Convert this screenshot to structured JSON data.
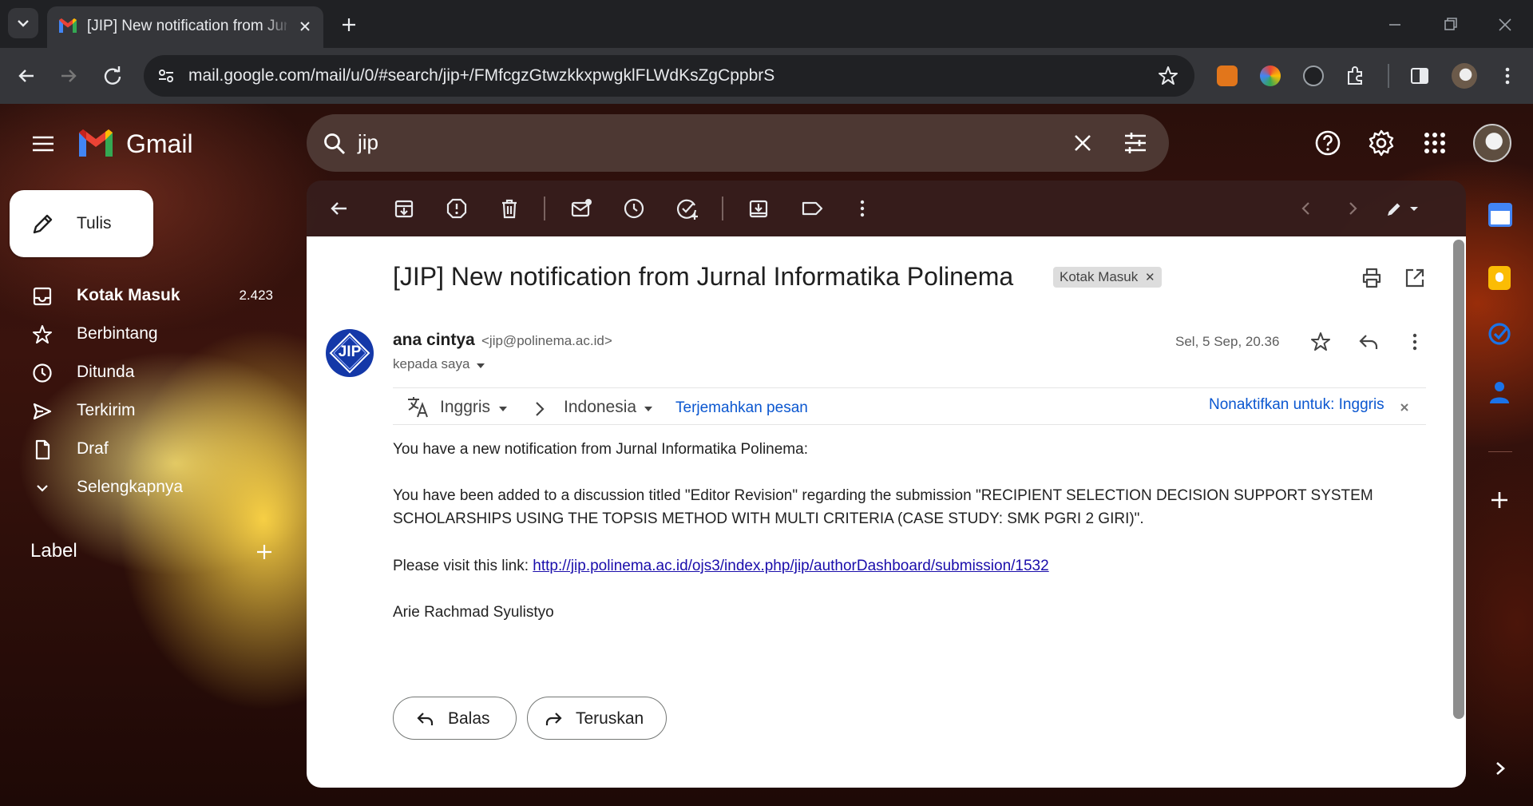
{
  "browser": {
    "tab_title": "[JIP] New notification from Jurnal Informatika Polinema",
    "url": "mail.google.com/mail/u/0/#search/jip+/FMfcgzGtwzkkxpwgklFLWdKsZgCppbrS"
  },
  "gmail": {
    "logo_text": "Gmail",
    "search_query": "jip",
    "compose_label": "Tulis",
    "nav": [
      {
        "label": "Kotak Masuk",
        "count": "2.423"
      },
      {
        "label": "Berbintang"
      },
      {
        "label": "Ditunda"
      },
      {
        "label": "Terkirim"
      },
      {
        "label": "Draf"
      },
      {
        "label": "Selengkapnya"
      }
    ],
    "labels_heading": "Label"
  },
  "message": {
    "subject": "[JIP] New notification from Jurnal Informatika Polinema",
    "label_chip": "Kotak Masuk",
    "sender_name": "ana cintya",
    "sender_email": "<jip@polinema.ac.id>",
    "to_line": "kepada saya",
    "date": "Sel, 5 Sep, 20.36",
    "avatar_text": "JIP",
    "translate": {
      "from_lang": "Inggris",
      "to_lang": "Indonesia",
      "translate_link": "Terjemahkan pesan",
      "disable_link": "Nonaktifkan untuk: Inggris"
    },
    "body": {
      "line1": "You have a new notification from Jurnal Informatika Polinema:",
      "line2a": "You have been added to a discussion titled \"Editor Revision\" regarding the submission \"RECIPIENT SELECTION DECISION SUPPORT SYSTEM",
      "line2b": "SCHOLARSHIPS USING THE TOPSIS METHOD WITH MULTI CRITERIA (CASE STUDY: SMK PGRI 2 GIRI)\".",
      "line3_prefix": "Please visit this link: ",
      "link": "http://jip.polinema.ac.id/ojs3/index.php/jip/authorDashboard/submission/1532",
      "signature": "Arie Rachmad Syulistyo"
    },
    "reply_label": "Balas",
    "forward_label": "Teruskan"
  },
  "colors": {
    "link_blue": "#0b57d0",
    "body_link": "#1a0dab",
    "gmail_red": "#ea4335"
  }
}
